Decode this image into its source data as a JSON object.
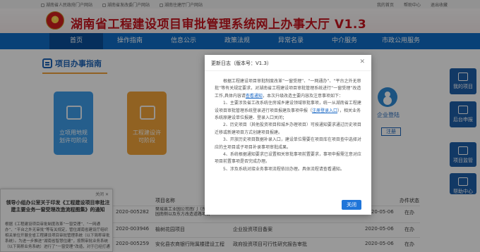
{
  "toplinks": {
    "left": [
      "湖南省人民政府门户网站",
      "湖南省发改委门户网站",
      "湖南住建厅门户网站"
    ],
    "right": [
      "我的首页",
      "帮助中心",
      "退出收藏"
    ]
  },
  "header": {
    "title": "湖南省工程建设项目审批管理系统网上办事大厅 V1.3"
  },
  "nav": [
    "首页",
    "操作指南",
    "信息公示",
    "政策法规",
    "异常名录",
    "中介服务",
    "市政公用服务"
  ],
  "section": {
    "title": "项目办事指南"
  },
  "cards": [
    {
      "label_line1": "立项用地规",
      "label_line2": "划许可阶段"
    },
    {
      "label_line1": "工程建设许",
      "label_line2": "可阶段"
    }
  ],
  "login": {
    "label": "企业登陆",
    "register": "注册"
  },
  "side_panel": [
    "我的项目",
    "后台申报",
    "项目监管",
    "帮助中心"
  ],
  "table": {
    "headers": {
      "name": "项目名称",
      "status": "办件状态"
    },
    "rows": [
      {
        "code": "2020-005282",
        "name": "樊城县工业园公司南门（东头山）请官公园南侧以及东方改造道路项目",
        "type": "",
        "date": "2020-05-06",
        "status": "在办"
      },
      {
        "code": "2020-003946",
        "name": "榆树花园项目",
        "type": "企业投资项目备案",
        "date": "2020-05-06",
        "status": "在办"
      },
      {
        "code": "2020-005259",
        "name": "安化县农商银行附属楼建设工程",
        "type": "政府投资项目可行性研究报告审批",
        "date": "2020-05-06",
        "status": "在办"
      }
    ]
  },
  "notice": {
    "close": "关闭 ✕",
    "title": "领导小组办公室关于印发《工程建设项目审批注建主要业务一窗受理改造流程图集》的通知",
    "body": "根据《工程建设项目审批制度改革“一窗受理”、“一网通办”、“平台之外无审批”等有关规定，管住湖南省建设厅组织相关单位开展全省工程建设项目审批管理系统（以下简称审批系统）。为进一步推进“湖南省智慧住建”，按照审批业务系统（以下简称业务系统）进行了“一窗受理”改造，对于已经打通的业务系统的项目，请及时注意做好的登录"
  },
  "modal": {
    "title": "更新日志（版本号：V1.3）",
    "close": "✕",
    "intro_pre": "根据工程建设项目审批制度改革“一窗受理”、“一网通办”、“平台之外无审批”等有关规定要求，对湖南省工程建设项目审批管理系统进行“一窗受理”改造工作,具体内容请",
    "intro_link": "查看通知",
    "intro_post": "，本次升级改造主要内容及注意事项如下：",
    "items": [
      {
        "pre": "1、主要涉及省工改系统住房城乡建设领域审批事项，统一从湖南省工程建设项目审批管理系统登录进行项目报建及事项申报（",
        "link": "注册登录入口",
        "post": "），相关业务系统原建设单位报建、登录入口关闭；"
      },
      {
        "pre": "2、历史项目（其他投资项目和城乡办理项目）可按通知要求通过历史项目迁移或新建项目方式创建项目报建。",
        "link": "",
        "post": ""
      },
      {
        "pre": "3、开放历史项目数据补录入口，建设单位需要在项目库在项目查中选择对应的主项目或子项目补录事项审批成果。",
        "link": "",
        "post": ""
      },
      {
        "pre": "4、系统根据通知要求已设置相关审批事项前置要求，事项申报需注意对应项目前置事项是否完成办理。",
        "link": "",
        "post": ""
      },
      {
        "pre": "5、涉及系统对接业务事项流程依旧办理。具体流程请查看通知。",
        "link": "",
        "post": ""
      }
    ],
    "ok": "关闭"
  }
}
